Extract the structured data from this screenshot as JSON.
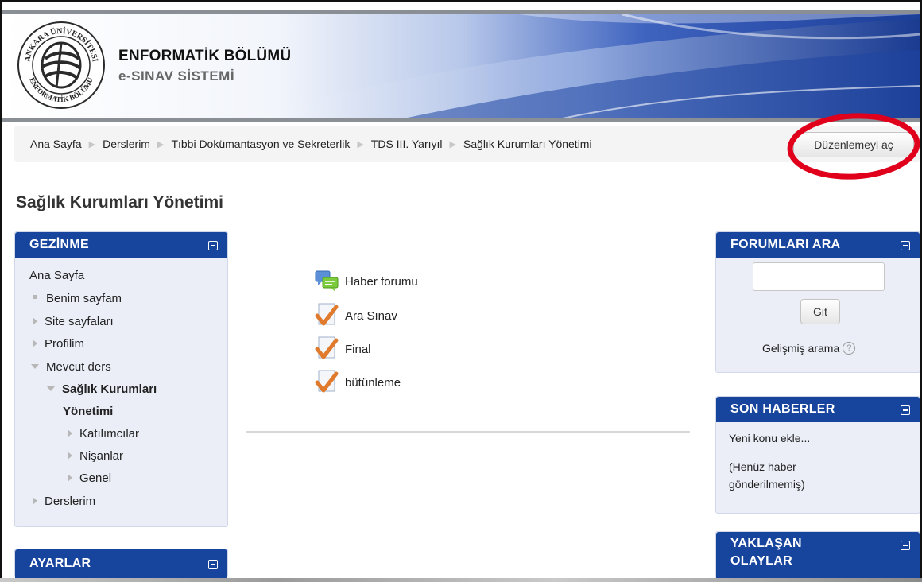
{
  "header": {
    "title": "ENFORMATİK BÖLÜMÜ",
    "subtitle": "e-SINAV SİSTEMİ",
    "logo_text_top": "ANKARA ÜNİVERSİTESİ",
    "logo_text_bottom": "ENFORMATİK BÖLÜMÜ"
  },
  "breadcrumb": [
    "Ana Sayfa",
    "Derslerim",
    "Tıbbi Dokümantasyon ve Sekreterlik",
    "TDS III. Yarıyıl",
    "Sağlık Kurumları Yönetimi"
  ],
  "edit_button_label": "Düzenlemeyi aç",
  "page_title": "Sağlık Kurumları Yönetimi",
  "navigation": {
    "title": "GEZİNME",
    "root": "Ana Sayfa",
    "benim_sayfam": "Benim sayfam",
    "site_sayfalari": "Site sayfaları",
    "profilim": "Profilim",
    "mevcut_ders": "Mevcut ders",
    "course_line1": "Sağlık Kurumları",
    "course_line2": "Yönetimi",
    "katilimcilar": "Katılımcılar",
    "nisanlar": "Nişanlar",
    "genel": "Genel",
    "derslerim": "Derslerim"
  },
  "settings_block": {
    "title": "AYARLAR"
  },
  "activities": [
    {
      "label": "Haber forumu",
      "icon": "forum-icon"
    },
    {
      "label": "Ara Sınav",
      "icon": "quiz-icon"
    },
    {
      "label": "Final",
      "icon": "quiz-icon"
    },
    {
      "label": "bütünleme",
      "icon": "quiz-icon"
    }
  ],
  "search_forums": {
    "title": "FORUMLARI ARA",
    "input_value": "",
    "button_label": "Git",
    "advanced_link": "Gelişmiş arama",
    "help_glyph": "?"
  },
  "latest_news": {
    "title": "SON HABERLER",
    "add_link": "Yeni konu ekle...",
    "empty_line1": "(Henüz haber",
    "empty_line2": "gönderilmemiş)"
  },
  "upcoming_events": {
    "title_line1": "YAKLAŞAN",
    "title_line2": "OLAYLAR"
  },
  "colors": {
    "block_header": "#17449d",
    "block_bg": "#ebeef7",
    "highlight_circle": "#e0001b",
    "quiz_check": "#e07a2c"
  }
}
